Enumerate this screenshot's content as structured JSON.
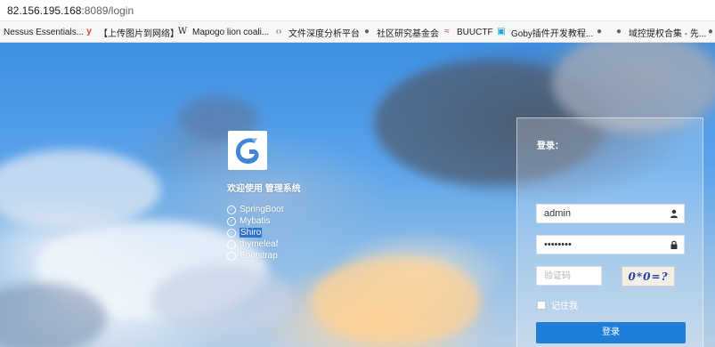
{
  "browser": {
    "url_host": "82.156.195.168",
    "url_rest": ":8089/login"
  },
  "bookmarks": [
    {
      "icon": "nessus-icon",
      "glyph": "",
      "label": "Nessus Essentials..."
    },
    {
      "icon": "y-icon",
      "glyph": "y",
      "label": "【上传图片到网络】"
    },
    {
      "icon": "wikipedia-icon",
      "glyph": "W",
      "label": "Mapogo lion coali..."
    },
    {
      "icon": "code-icon",
      "glyph": "‹›",
      "label": "文件深度分析平台"
    },
    {
      "icon": "globe-icon",
      "glyph": "●",
      "label": "社区研究基金会"
    },
    {
      "icon": "buuctf-icon",
      "glyph": "≈",
      "label": "BUUCTF"
    },
    {
      "icon": "bilibili-icon",
      "glyph": "▣",
      "label": "Goby插件开发教程..."
    },
    {
      "icon": "globe-icon",
      "glyph": "●",
      "label": ""
    },
    {
      "icon": "globe-icon",
      "glyph": "●",
      "label": "域控提权合集 - 先..."
    },
    {
      "icon": "globe-icon",
      "glyph": "●",
      "label": ""
    }
  ],
  "welcome": {
    "title": "欢迎使用 管理系统"
  },
  "tech_list": [
    {
      "label": "SpringBoot",
      "highlight": false
    },
    {
      "label": "Mybatis",
      "highlight": false
    },
    {
      "label": "Shiro",
      "highlight": true
    },
    {
      "label": "thymeleaf",
      "highlight": false
    },
    {
      "label": "Bootstrap",
      "highlight": false
    }
  ],
  "login": {
    "title": "登录：",
    "username_value": "admin",
    "password_value": "••••••••",
    "captcha_placeholder": "验证码",
    "captcha_text": "0*0=?",
    "remember_label": "记住我",
    "submit_label": "登录"
  },
  "colors": {
    "accent": "#1e7fd8",
    "highlight": "#2f74d0"
  }
}
